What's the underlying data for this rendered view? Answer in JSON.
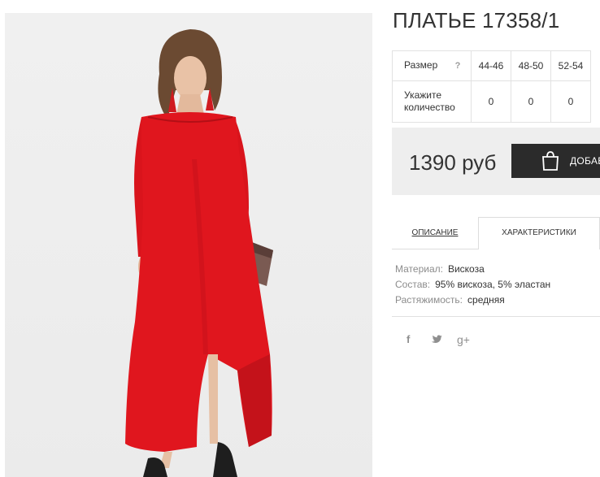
{
  "product": {
    "title": "ПЛАТЬЕ 17358/1",
    "image_alt_icon": "product-photo"
  },
  "size_table": {
    "size_label": "Размер",
    "help_mark": "?",
    "sizes": [
      "44-46",
      "48-50",
      "52-54"
    ],
    "qty_label_line1": "Укажите",
    "qty_label_line2": "количество",
    "quantities": [
      "0",
      "0",
      "0"
    ]
  },
  "purchase": {
    "price": "1390 руб",
    "add_button_label": "ДОБАВ",
    "add_button_icon": "shopping-bag-icon"
  },
  "tabs": {
    "items": [
      {
        "label": "ОПИСАНИЕ",
        "active": false
      },
      {
        "label": "ХАРАКТЕРИСТИКИ",
        "active": true
      }
    ]
  },
  "specs": [
    {
      "key": "Материал:",
      "value": "Вискоза"
    },
    {
      "key": "Состав:",
      "value": "95% вискоза, 5% эластан"
    },
    {
      "key": "Растяжимость:",
      "value": "средняя"
    }
  ],
  "social": {
    "facebook": "f",
    "twitter": "twitter-bird",
    "google_plus": "g+"
  },
  "colors": {
    "dress": "#e0161e",
    "button_bg": "#2b2b2b",
    "price_bg": "#eeeeee"
  }
}
